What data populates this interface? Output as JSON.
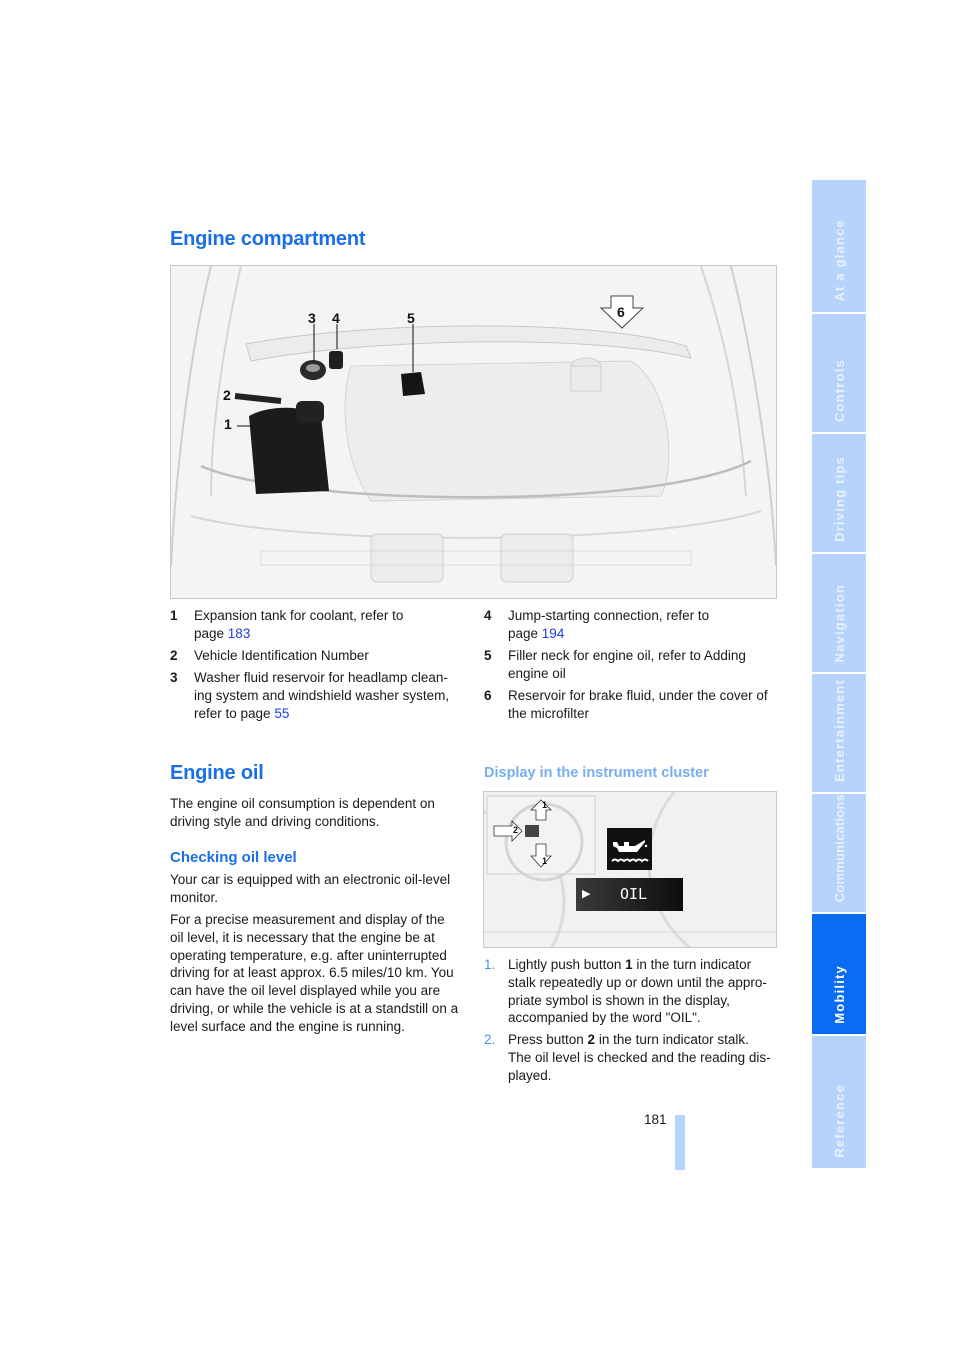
{
  "sidebar": {
    "tabs": [
      {
        "label": "At a glance",
        "active": false
      },
      {
        "label": "Controls",
        "active": false
      },
      {
        "label": "Driving tips",
        "active": false
      },
      {
        "label": "Navigation",
        "active": false
      },
      {
        "label": "Entertainment",
        "active": false
      },
      {
        "label": "Communications",
        "active": false
      },
      {
        "label": "Mobility",
        "active": true
      },
      {
        "label": "Reference",
        "active": false
      }
    ]
  },
  "section1": {
    "title": "Engine compartment",
    "figure": {
      "callouts": [
        "1",
        "2",
        "3",
        "4",
        "5",
        "6"
      ]
    },
    "legend": [
      {
        "num": "1",
        "text": "Expansion tank for coolant, refer to",
        "text2_prefix": "page ",
        "link": "183"
      },
      {
        "num": "2",
        "text": "Vehicle Identification Number"
      },
      {
        "num": "3",
        "text": "Washer fluid reservoir for headlamp clean-",
        "text2": "ing system and windshield washer system,",
        "text3_prefix": "refer to page ",
        "link": "55"
      },
      {
        "num": "4",
        "text": "Jump-starting connection, refer to",
        "text2_prefix": "page ",
        "link": "194"
      },
      {
        "num": "5",
        "text": "Filler neck for engine oil, refer to Adding",
        "text2": "engine oil"
      },
      {
        "num": "6",
        "text": "Reservoir for brake fluid, under the cover of",
        "text2": "the microfilter"
      }
    ]
  },
  "section2": {
    "title": "Engine oil",
    "intro": [
      "The engine oil consumption is dependent on",
      "driving style and driving conditions."
    ],
    "subheading": "Checking oil level",
    "para1": [
      "Your car is equipped with an electronic oil-level",
      "monitor."
    ],
    "para2": [
      "For a precise measurement and display of the",
      "oil level, it is necessary that the engine be at",
      "operating temperature, e.g. after uninterrupted",
      "driving for at least approx. 6.5 miles/10 km. You",
      "can have the oil level displayed while you are",
      "driving, or while the vehicle is at a standstill on a",
      "level surface and the engine is running."
    ],
    "display_heading": "Display in the instrument cluster",
    "cluster": {
      "display_text": "OIL",
      "stalk_labels": [
        "1",
        "2",
        "1"
      ]
    },
    "steps": [
      {
        "num": "1.",
        "pre": "Lightly push button ",
        "bold": "1",
        "post": " in the turn indicator",
        "lines": [
          "stalk repeatedly up or down until the appro-",
          "priate symbol is shown in the display,",
          "accompanied by the word \"OIL\"."
        ]
      },
      {
        "num": "2.",
        "pre": "Press button ",
        "bold": "2",
        "post": " in the turn indicator stalk.",
        "lines": [
          "The oil level is checked and the reading dis-",
          "played."
        ]
      }
    ]
  },
  "footer": {
    "page_number": "181"
  }
}
